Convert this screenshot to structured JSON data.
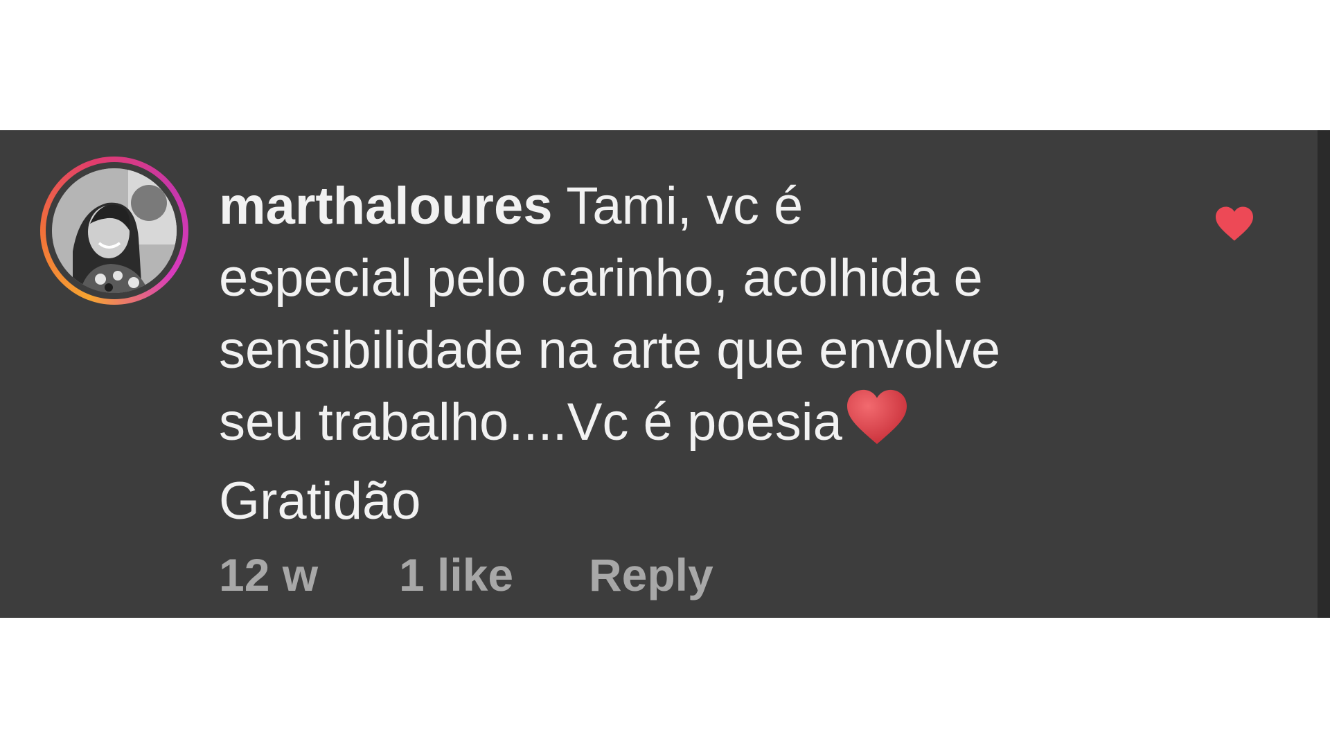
{
  "comment": {
    "username": "marthaloures",
    "text_lines": [
      "Tami, vc é",
      "especial pelo carinho, acolhida e",
      "sensibilidade na arte que envolve",
      "seu trabalho....Vc é poesia",
      "Gratidão"
    ],
    "inline_emoji": "red-heart",
    "time_ago": "12 w",
    "likes": "1 like",
    "reply_label": "Reply",
    "liked": true
  },
  "colors": {
    "card_background": "#3d3d3d",
    "text": "#f2f2f2",
    "meta_text": "#a8a8a8",
    "like_heart": "#ed4956",
    "emoji_heart": "#e0404a",
    "story_ring": [
      "#f7a531",
      "#e13c6d",
      "#c837ab"
    ]
  },
  "icons": {
    "like": "heart-icon",
    "avatar": "profile-avatar"
  }
}
